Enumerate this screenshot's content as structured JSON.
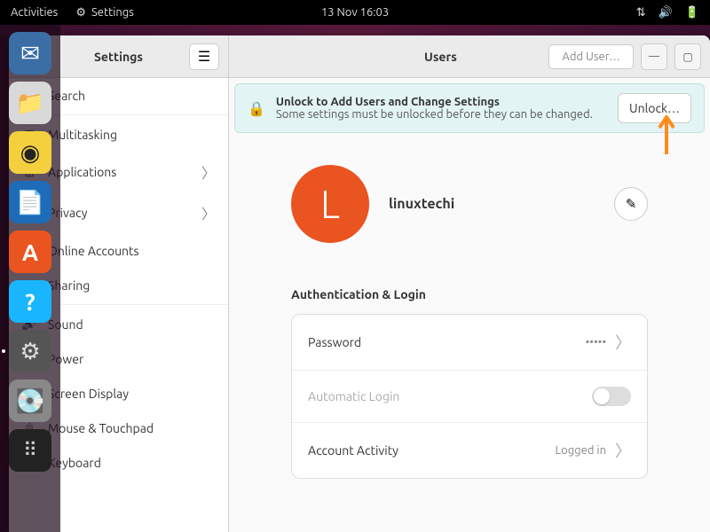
{
  "topbar": {
    "activities": "Activities",
    "app_name": "Settings",
    "clock": "13 Nov  16:03"
  },
  "dock": {
    "items": [
      {
        "name": "thunderbird",
        "bg": "#3a6ea5",
        "glyph": "✉"
      },
      {
        "name": "files",
        "bg": "#d9d9d9",
        "glyph": "📁"
      },
      {
        "name": "rhythmbox",
        "bg": "#222",
        "glyph": "◉"
      },
      {
        "name": "libreoffice",
        "bg": "#1e6bb8",
        "glyph": "📄"
      },
      {
        "name": "software",
        "bg": "#e95420",
        "glyph": "A"
      },
      {
        "name": "help",
        "bg": "#19b5fe",
        "glyph": "?"
      },
      {
        "name": "settings",
        "bg": "#555",
        "glyph": "⚙",
        "active": true
      },
      {
        "name": "disks",
        "bg": "#888",
        "glyph": "💽"
      },
      {
        "name": "show-apps",
        "bg": "#222",
        "glyph": "⠿"
      }
    ]
  },
  "window": {
    "title_left": "Settings",
    "title_right": "Users",
    "add_user": "Add User…"
  },
  "sidebar": {
    "items": [
      {
        "icon": "🔍",
        "label": "Search"
      },
      {
        "icon": "⊞",
        "label": "Multitasking"
      },
      {
        "icon": "⊞",
        "label": "Applications",
        "expandable": true
      },
      {
        "icon": "🛡",
        "label": "Privacy",
        "expandable": true
      },
      {
        "icon": "☁",
        "label": "Online Accounts"
      },
      {
        "icon": "∝",
        "label": "Sharing"
      },
      {
        "icon": "🔊",
        "label": "Sound"
      },
      {
        "icon": "⏻",
        "label": "Power"
      },
      {
        "icon": "🖵",
        "label": "Screen Display"
      },
      {
        "icon": "🖱",
        "label": "Mouse & Touchpad"
      },
      {
        "icon": "⌨",
        "label": "Keyboard"
      }
    ]
  },
  "infobar": {
    "title": "Unlock to Add Users and Change Settings",
    "subtitle": "Some settings must be unlocked before they can be changed.",
    "button": "Unlock…"
  },
  "user": {
    "initial": "L",
    "name": "linuxtechi"
  },
  "auth": {
    "section_title": "Authentication & Login",
    "password_label": "Password",
    "password_value": "•••••",
    "auto_login_label": "Automatic Login",
    "activity_label": "Account Activity",
    "activity_value": "Logged in"
  }
}
